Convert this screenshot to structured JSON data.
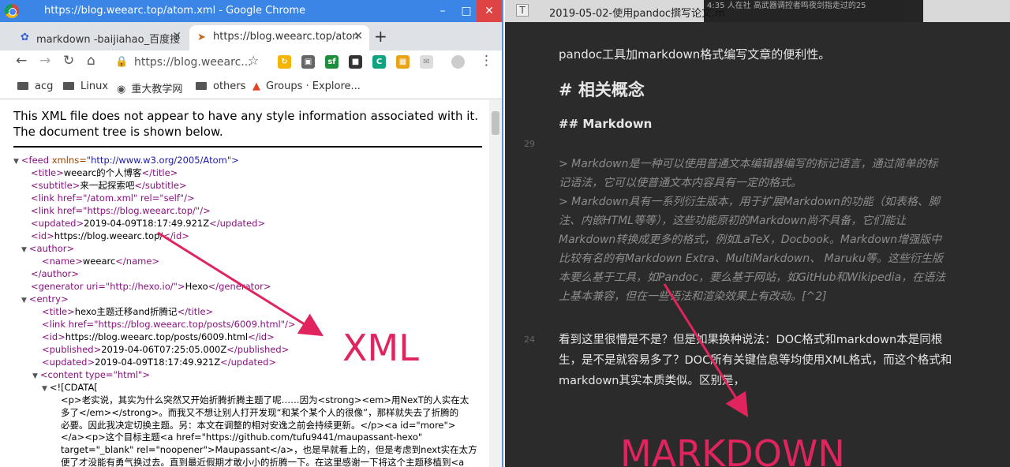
{
  "chrome": {
    "window_title": "https://blog.weearc.top/atom.xml - Google Chrome",
    "tabs": [
      {
        "label": "markdown -baijiahao_百度搜",
        "favicon": "paw-icon"
      },
      {
        "label": "https://blog.weearc.top/aton",
        "favicon": "pin-icon"
      }
    ],
    "omnibox": "https://blog.weearc...",
    "bookmarks": [
      {
        "label": "acg",
        "icon": "folder-icon"
      },
      {
        "label": "Linux",
        "icon": "folder-icon"
      },
      {
        "label": "重大教学网",
        "icon": "globe-icon"
      },
      {
        "label": "others",
        "icon": "folder-icon"
      },
      {
        "label": "Groups · Explore...",
        "icon": "gitlab-icon"
      }
    ],
    "notice": "This XML file does not appear to have any style information associated with it. The document tree is shown below.",
    "xml": {
      "feed_open": "<feed",
      "feed_attr": "xmlns=",
      "feed_val": "\"http://www.w3.org/2005/Atom\">",
      "title": "weearc的个人博客",
      "subtitle": "来一起探索吧",
      "link_self": "<link href=\"/atom.xml\" rel=\"self\"/>",
      "link_home": "<link href=\"https://blog.weearc.top/\"/>",
      "updated": "2019-04-09T18:17:49.921Z",
      "id": "https://blog.weearc.top/",
      "author_open": "<author>",
      "name": "weearc",
      "author_close": "</author>",
      "generator_uri": "<generator uri=\"http://hexo.io/\">",
      "generator": "Hexo",
      "entry_open": "<entry>",
      "entry_title": "hexo主题迁移and折腾记",
      "entry_link": "<link href=\"https://blog.weearc.top/posts/6009.html\"/>",
      "entry_id": "https://blog.weearc.top/posts/6009.html",
      "published": "2019-04-06T07:25:05.000Z",
      "entry_updated": "2019-04-09T18:17:49.921Z",
      "content_open": "<content type=\"html\">",
      "cdata_open": "<![CDATA[",
      "cdata_lines": [
        "<p>老实说，其实为什么突然又开始折腾折腾主题了呢……因为<strong><em>用NexT的人实在太",
        "多了</em></strong>。而我又不想让别人打开发现“和某个某个人的很像”，那样就失去了折腾的",
        "必要。因此我决定切换主题。另：本文在调整的相对安逸之前会持续更新。</p><a id=\"more\">",
        "</a><p>这个目标主题<a href=\"https://github.com/tufu9441/maupassant-hexo\"",
        "target=\"_blank\" rel=\"noopener\">Maupassant</a>，也是早就看上的，但是考虑到next实在太方",
        "便了才没能有勇气换过去。直到最近假期才敢小小的折腾一下。在这里感谢一下将这个主题移植到<a"
      ]
    }
  },
  "editor": {
    "doc_title": "2019-05-02-使用pandoc撰写论文.m",
    "overlay": "4:35 人在社 高武器调控者鸣夜剑指走过的25",
    "intro": "pandoc工具加markdown格式编写文章的便利性。",
    "h1": "# 相关概念",
    "h2": "## Markdown",
    "line_29": "29",
    "line_24": "24",
    "quote": [
      ">  Markdown是一种可以使用普通文本编辑器编写的标记语言，通过简单的标",
      "记语法，它可以使普通文本内容具有一定的格式。",
      ">  Markdown具有一系列衍生版本，用于扩展Markdown的功能（如表格、脚",
      "注、内嵌HTML等等），这些功能原初的Markdown尚不具备，它们能让",
      "Markdown转换成更多的格式，例如LaTeX，Docbook。Markdown增强版中",
      "比较有名的有Markdown Extra、MultiMarkdown、 Maruku等。这些衍生版",
      "本要么基于工具，如Pandoc，要么基于网站，如GitHub和Wikipedia，在语法",
      "上基本兼容，但在一些语法和渲染效果上有改动。[^2]"
    ],
    "para": [
      "看到这里很懵是不是？但是如果换种说法：DOC格式和markdown本是同根",
      "生，是不是就容易多了？DOC所有关键信息等均使用XML格式，而这个格式和",
      "markdown其实本质类似。区别是，"
    ]
  },
  "annotations": {
    "xml": "XML",
    "markdown": "MARKDOWN",
    "color": "#e0245e"
  }
}
